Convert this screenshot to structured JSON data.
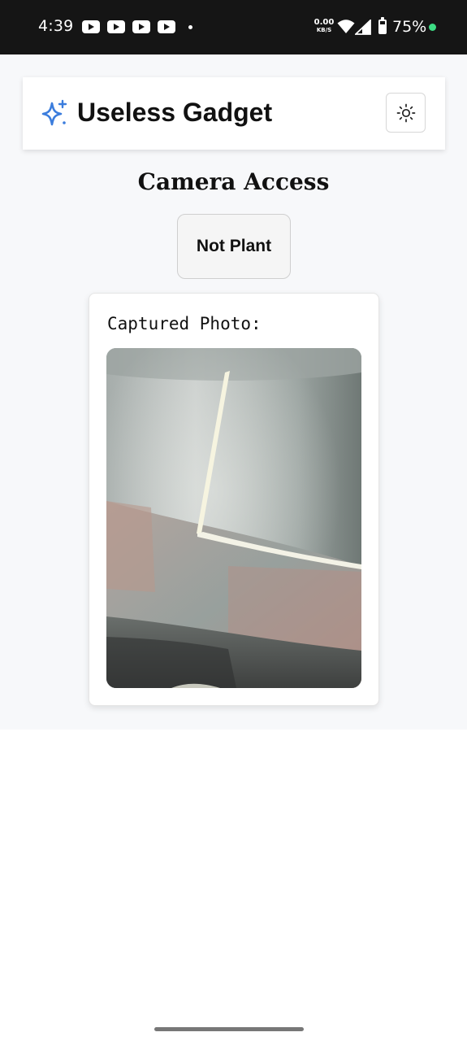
{
  "status_bar": {
    "time": "4:39",
    "net_speed_value": "0.00",
    "net_speed_unit": "KB/S",
    "battery": "75%",
    "notification_icons": [
      "youtube-icon",
      "youtube-icon",
      "youtube-icon",
      "youtube-icon"
    ]
  },
  "header": {
    "title": "Useless Gadget",
    "logo_icon": "sparkle-icon",
    "theme_toggle_icon": "sun-icon"
  },
  "main": {
    "title": "Camera Access",
    "result_button": "Not Plant",
    "photo_label": "Captured Photo:"
  },
  "colors": {
    "accent": "#3b7ddd",
    "page_background": "#f7f8fa",
    "status_bar": "#151515",
    "charging_dot": "#3ddc84"
  }
}
